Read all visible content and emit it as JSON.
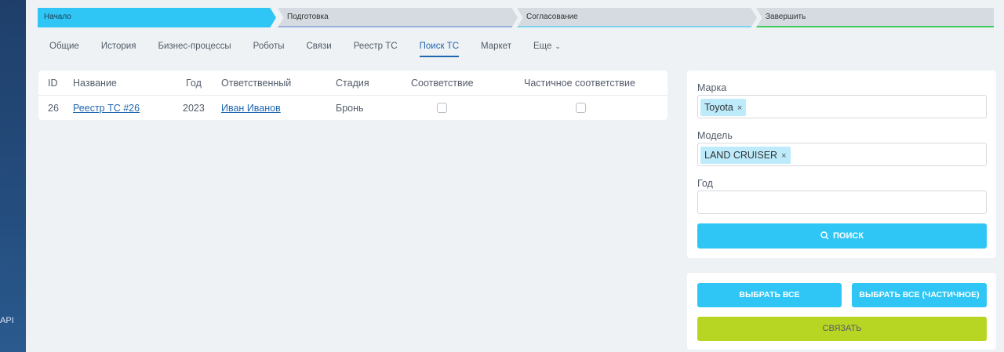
{
  "sidebar": {
    "api_label": "API"
  },
  "stages": [
    "Начало",
    "Подготовка",
    "Согласование",
    "Завершить"
  ],
  "tabs": [
    {
      "label": "Общие",
      "active": false
    },
    {
      "label": "История",
      "active": false
    },
    {
      "label": "Бизнес-процессы",
      "active": false
    },
    {
      "label": "Роботы",
      "active": false
    },
    {
      "label": "Связи",
      "active": false
    },
    {
      "label": "Реестр ТС",
      "active": false
    },
    {
      "label": "Поиск ТС",
      "active": true
    },
    {
      "label": "Маркет",
      "active": false
    },
    {
      "label": "Еще",
      "active": false
    }
  ],
  "table": {
    "headers": [
      "ID",
      "Название",
      "Год",
      "Ответственный",
      "Стадия",
      "Соответствие",
      "Частичное соответствие"
    ],
    "rows": [
      {
        "id": "26",
        "name": "Реестр ТС #26",
        "year": "2023",
        "responsible": "Иван Иванов",
        "stage": "Бронь",
        "match": false,
        "partial_match": false
      }
    ]
  },
  "filter": {
    "brand_label": "Марка",
    "brand_tag": "Toyota",
    "model_label": "Модель",
    "model_tag": "LAND CRUISER",
    "year_label": "Год",
    "year_value": "",
    "search_button": "ПОИСК"
  },
  "actions": {
    "select_all": "ВЫБРАТЬ ВСЕ",
    "select_all_partial": "ВЫБРАТЬ ВСЕ (ЧАСТИЧНОЕ)",
    "link": "СВЯЗАТЬ"
  },
  "colors": {
    "accent": "#2fc6f6",
    "link_button": "#b7d523",
    "active_tab": "#2067b0",
    "sidebar": "#244d7e"
  }
}
